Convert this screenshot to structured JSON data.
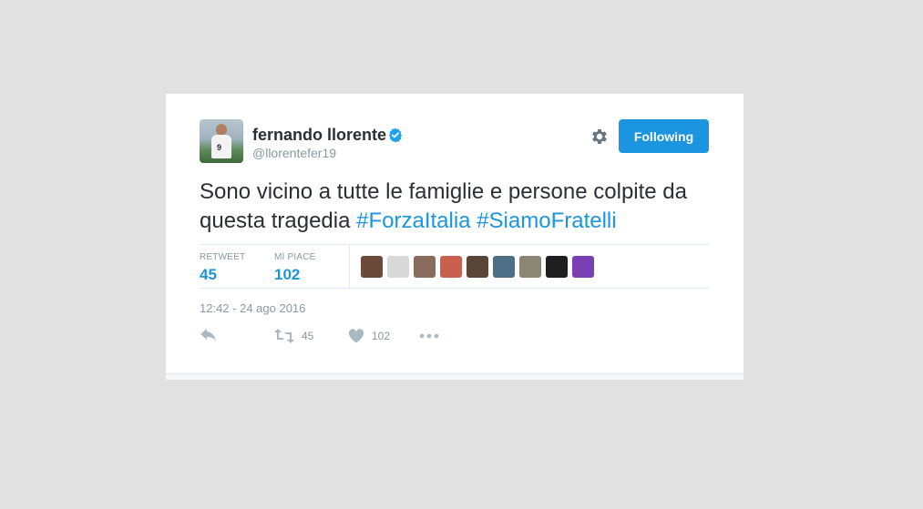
{
  "tweet": {
    "author_name": "fernando llorente",
    "author_handle": "@llorentefer19",
    "avatar_number": "9",
    "follow_label": "Following",
    "text_plain": "Sono vicino a tutte le famiglie e persone colpite da questa tragedia ",
    "hashtags": [
      "#ForzaItalia",
      "#SiamoFratelli"
    ],
    "timestamp": "12:42 - 24 ago 2016"
  },
  "stats": {
    "retweet_label": "RETWEET",
    "retweet_count": "45",
    "likes_label": "MI PIACE",
    "likes_count": "102"
  },
  "likers": [
    {
      "name": "liker-1",
      "color": "#6b4a3a"
    },
    {
      "name": "liker-2",
      "color": "#d9d9d9"
    },
    {
      "name": "liker-3",
      "color": "#8a6b5c"
    },
    {
      "name": "liker-4",
      "color": "#c9604f"
    },
    {
      "name": "liker-5",
      "color": "#5a4436"
    },
    {
      "name": "liker-6",
      "color": "#4c6f86"
    },
    {
      "name": "liker-7",
      "color": "#8c8576"
    },
    {
      "name": "liker-8",
      "color": "#1e1e1e"
    },
    {
      "name": "liker-9",
      "color": "#7a3fb2"
    }
  ],
  "actions": {
    "retweet_count": "45",
    "like_count": "102"
  },
  "colors": {
    "accent": "#1b95e0",
    "background": "#e1e1e1",
    "text": "#292f33",
    "muted": "#8899a6"
  },
  "icons": [
    "verified-badge-icon",
    "gear-icon",
    "reply-icon",
    "retweet-icon",
    "heart-icon",
    "more-icon"
  ]
}
